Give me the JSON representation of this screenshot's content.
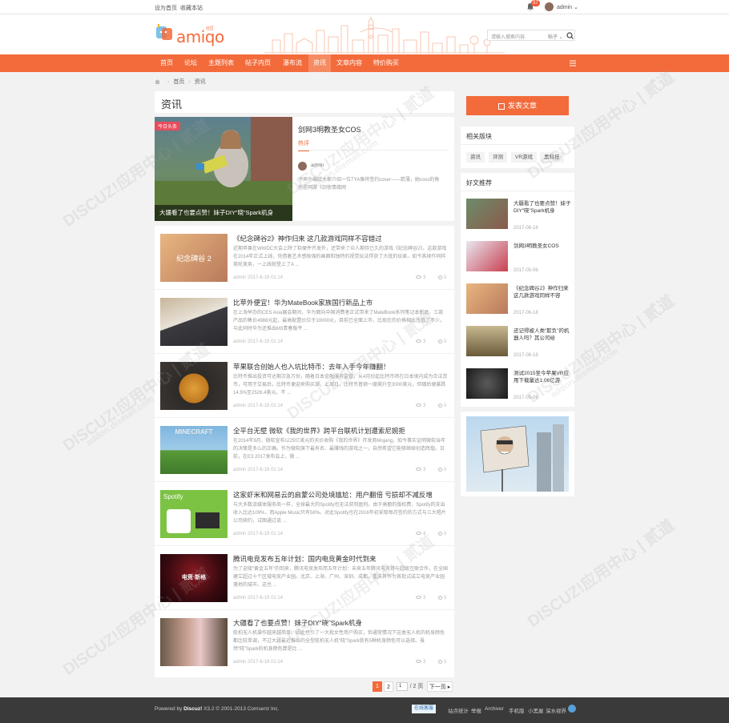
{
  "topbar": {
    "set_home": "设为首页",
    "favorite": "收藏本站",
    "badge": "37",
    "user": "admin"
  },
  "header": {
    "logo_text": "amiqo",
    "logo_sub": "社区",
    "search_placeholder": "请输入搜索内容",
    "search_type": "帖子"
  },
  "nav": {
    "items": [
      "首页",
      "论坛",
      "主题列表",
      "帖子内页",
      "瀑布流",
      "资讯",
      "文章内容",
      "特价购买"
    ]
  },
  "breadcrumb": {
    "home": "首页",
    "current": "资讯"
  },
  "page_title": "资讯",
  "featured": {
    "tag": "今日头条",
    "caption": "大疆看了也要点赞！妹子DIY“晓”Spark机身",
    "title": "剑网3明教圣女COS",
    "tab": "热评",
    "author": "admin",
    "desc": "今天小编给大家介绍一位TYA像将签约coser——箭薄，她coss的角色是网游《剑侠情缘网"
  },
  "articles": [
    {
      "title": "《纪念碑谷2》神作归来 这几款游戏同样不容错过",
      "desc": "近期苹果在WWDC大会上除了软硬件齐发外，还带来了众人期待已久的游戏《纪念碑谷2》。这款游戏在2014年正式上线，凭借着艺术感极强的画面和独特的视觉玩法俘获了大批的玩家。如今其续作同样美轮美奂，一上线就登上了A ...",
      "meta": "admin 2017-6-19 01:14",
      "views": "3",
      "comments": "0",
      "thumb_label": "纪念碑谷 2"
    },
    {
      "title": "比苹外便宜！华为MateBook家族国行新品上市",
      "desc": "在上海举办的CES Asia展会期间，华为面向中国消费者正式带来了MateBook系列笔记本新品，三款产品的售价4988元起，最高配置价位于10000元，目前已全面上市，比现在的价格相比也低了不少。与此同时华为还推出M3青春版平 ...",
      "meta": "admin 2017-6-19 01:14",
      "views": "3",
      "comments": "0",
      "thumb_label": ""
    },
    {
      "title": "苹果联合创始人也入坑比特币：去年入手今年赚翻！",
      "desc": "比特币推出投资可达期次急万份，随着日本金融服务监管，从4月份起比特币将在日本境内成为合法货币，可用于交易后，比特币便迎来购买潮，上周日，比特币普顿一度飙升至3000美元，但随后便暴跌14.5%至2526.4美元。不 ...",
      "meta": "admin 2017-6-19 01:14",
      "views": "3",
      "comments": "0",
      "thumb_label": ""
    },
    {
      "title": "全平台无壁 微软《我的世界》跨平台联机计划遭索尼婉拒",
      "desc": "在2014年9月，微软宣布以25亿美元的天价收购《我的世界》开发商Mojang，如今事实证明微软当年的决策是多么的正确。作为微软旗下最有名、最赚钱的游戏之一，自然希望它能够继续创造辉煌。日前，在E3 2017发布会上，微 ...",
      "meta": "admin 2017-6-19 01:14",
      "views": "3",
      "comments": "0",
      "thumb_label": "MINECRAFT"
    },
    {
      "title": "这家虾米和网易云的启蒙公司处境尴尬：用户翻倍 亏损却不减反增",
      "desc": "与大多数流媒体服务商一样，全球最大的Spotify也无法获到盈利。由于高额的版权费，Spotify的支出收入比达109%，而Apple Music只有58%。对此Spotify也在2016年初采取每月签约的方式与三大唱片公司续约，试图通过谈 ...",
      "meta": "admin 2017-6-19 01:14",
      "views": "4",
      "comments": "0",
      "thumb_label": "Spotify"
    },
    {
      "title": "腾讯电竞发布五年计划：国内电竞黄金时代到来",
      "desc": "为了迎接“黄金五年”的到来，腾讯电竞发布而五年计划：未来五年腾讯电竞将与超级互联合作，在全国建立超过十个区域电竞产业园。北京、上海、广州、深圳、成都、重庆将作为首批试成立电竞产业园落地的城市。这也 ...",
      "meta": "admin 2017-6-19 01:14",
      "views": "3",
      "comments": "0",
      "thumb_label": "电竞·新格"
    },
    {
      "title": "大疆看了也要点赞！妹子DIY“晓”Spark机身",
      "desc": "航拍无人机操作越来越简单，因此也引了一大批女性用户购买，但通常情况下这类无人机的机身颜色都比较单调，不过大疆最近推出的全型航拍无人机“晓”Spark就有5种机身颜色可以选择。虽然“晓”Spark的机身颜色算是比 ...",
      "meta": "admin 2017-6-19 01:14",
      "views": "3",
      "comments": "0",
      "thumb_label": ""
    }
  ],
  "pager": {
    "pages": [
      "1",
      "2"
    ],
    "input": "1",
    "total": "/ 2 页",
    "next": "下一页"
  },
  "sidebar": {
    "post_button": "发表文章",
    "related_title": "相关版块",
    "related": [
      "资讯",
      "评测",
      "VR游戏",
      "黑科技"
    ],
    "recommend_title": "好文推荐",
    "recommend": [
      {
        "title": "大疆看了也要点赞！妹子DIY“晓”Spark机身",
        "date": "2017-06-18"
      },
      {
        "title": "剑网3明教圣女COS",
        "date": "2017-05-06"
      },
      {
        "title": "《纪念碑谷2》神作归来 这几款游戏同样不容",
        "date": "2017-06-18"
      },
      {
        "title": "还记得被人类“欺负”的机器人吗？其公司给",
        "date": "2017-06-18"
      },
      {
        "title": "测试2015至今苹果VR应用下载量达1.06亿游",
        "date": "2017-05-06"
      }
    ]
  },
  "footer": {
    "powered": "Powered by",
    "brand": "Discuz!",
    "version": "X3.2  © 2001-2013 Comsenz Inc.",
    "online": "在线客服",
    "links": [
      "站点统计",
      "举报",
      "Archiver",
      "手机版",
      "小黑屋",
      "深水视界"
    ]
  },
  "watermark": "DISCUZ!应用中心 | 贰道",
  "watermark_sub": "addon.dismall.com",
  "colors": {
    "accent": "#f36b3b",
    "nav": "#f36b3b",
    "footer": "#3a3a3a"
  }
}
